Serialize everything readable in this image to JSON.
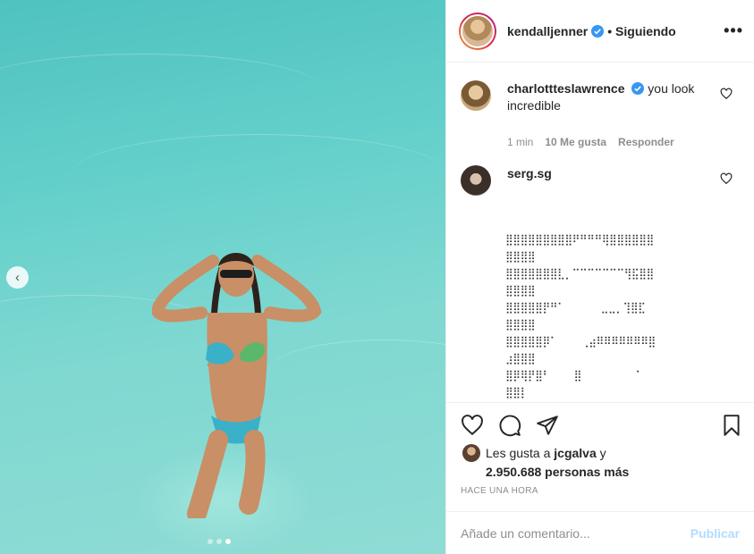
{
  "header": {
    "username": "kendalljenner",
    "follow_status": "• Siguiendo",
    "more_icon": "more-options-icon"
  },
  "media": {
    "prev_icon": "chevron-left-icon",
    "prev_glyph": "‹",
    "dots": 3,
    "active_dot": 3
  },
  "comments": [
    {
      "username": "charlottteslawrence",
      "text": "you look incredible",
      "time": "1 min",
      "likes": "10 Me gusta",
      "reply": "Responder"
    },
    {
      "username": "serg.sg",
      "ascii": "⣿⣿⣿⣿⣿⣿⣿⣿⣿⠟⠛⠛⠛⢿⣿⣿⣿⣿⣿⣿\n⣿⣿⣿⣿\n⣿⣿⣿⣿⣿⣿⣿⣇⡀⠉⠉⠉⠉⠉⠉⠉⢻⣯⣿⣿\n⣿⣿⣿⣿\n⣿⣿⣿⣿⣿⡟⠛⠁      ⣀⣀⡀⢹⣿⣏\n⣿⣿⣿⣿\n⣿⣿⣿⣿⣿⡿⠁    ⢀⣴⠿⠿⠿⠿⠿⠿⠿⣿\n⣰⣿⣿⣿\n⣿⡿⢿⡟⣿⠃    ⣿         ⠁\n⣿⣿⡇\n⣟⣿⠍⠙⣿    ⣿⡀"
    }
  ],
  "actions": {
    "like_icon": "heart-icon",
    "comment_icon": "comment-icon",
    "share_icon": "send-icon",
    "save_icon": "bookmark-icon"
  },
  "likes": {
    "prefix": "Les gusta a ",
    "user": "jcgalva",
    "suffix": " y",
    "count": "2.950.688 personas más"
  },
  "time_ago": "HACE UNA HORA",
  "add_comment": {
    "placeholder": "Añade un comentario...",
    "publish": "Publicar"
  },
  "colors": {
    "verified": "#3897f0",
    "publish_disabled": "#b3dbff",
    "water": "#63cfca"
  }
}
